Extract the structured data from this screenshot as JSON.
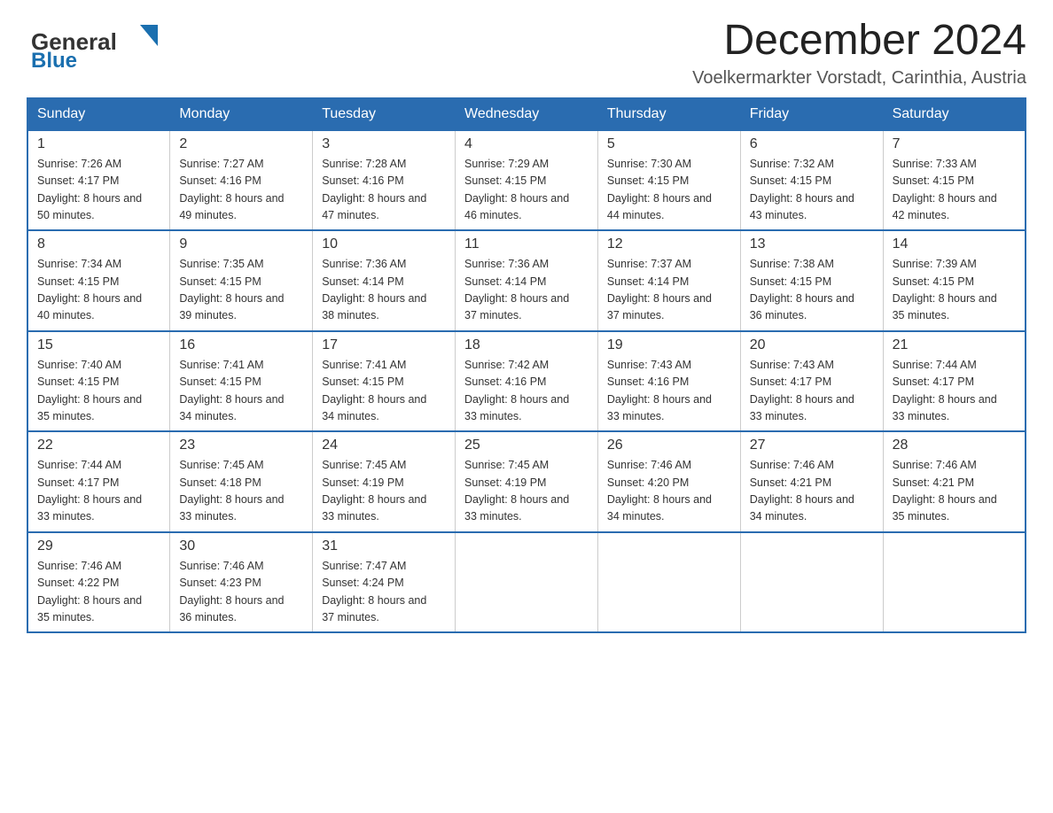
{
  "header": {
    "logo_general": "General",
    "logo_blue": "Blue",
    "month_title": "December 2024",
    "location": "Voelkermarkter Vorstadt, Carinthia, Austria"
  },
  "weekdays": [
    "Sunday",
    "Monday",
    "Tuesday",
    "Wednesday",
    "Thursday",
    "Friday",
    "Saturday"
  ],
  "weeks": [
    [
      {
        "day": "1",
        "sunrise": "7:26 AM",
        "sunset": "4:17 PM",
        "daylight": "8 hours and 50 minutes."
      },
      {
        "day": "2",
        "sunrise": "7:27 AM",
        "sunset": "4:16 PM",
        "daylight": "8 hours and 49 minutes."
      },
      {
        "day": "3",
        "sunrise": "7:28 AM",
        "sunset": "4:16 PM",
        "daylight": "8 hours and 47 minutes."
      },
      {
        "day": "4",
        "sunrise": "7:29 AM",
        "sunset": "4:15 PM",
        "daylight": "8 hours and 46 minutes."
      },
      {
        "day": "5",
        "sunrise": "7:30 AM",
        "sunset": "4:15 PM",
        "daylight": "8 hours and 44 minutes."
      },
      {
        "day": "6",
        "sunrise": "7:32 AM",
        "sunset": "4:15 PM",
        "daylight": "8 hours and 43 minutes."
      },
      {
        "day": "7",
        "sunrise": "7:33 AM",
        "sunset": "4:15 PM",
        "daylight": "8 hours and 42 minutes."
      }
    ],
    [
      {
        "day": "8",
        "sunrise": "7:34 AM",
        "sunset": "4:15 PM",
        "daylight": "8 hours and 40 minutes."
      },
      {
        "day": "9",
        "sunrise": "7:35 AM",
        "sunset": "4:15 PM",
        "daylight": "8 hours and 39 minutes."
      },
      {
        "day": "10",
        "sunrise": "7:36 AM",
        "sunset": "4:14 PM",
        "daylight": "8 hours and 38 minutes."
      },
      {
        "day": "11",
        "sunrise": "7:36 AM",
        "sunset": "4:14 PM",
        "daylight": "8 hours and 37 minutes."
      },
      {
        "day": "12",
        "sunrise": "7:37 AM",
        "sunset": "4:14 PM",
        "daylight": "8 hours and 37 minutes."
      },
      {
        "day": "13",
        "sunrise": "7:38 AM",
        "sunset": "4:15 PM",
        "daylight": "8 hours and 36 minutes."
      },
      {
        "day": "14",
        "sunrise": "7:39 AM",
        "sunset": "4:15 PM",
        "daylight": "8 hours and 35 minutes."
      }
    ],
    [
      {
        "day": "15",
        "sunrise": "7:40 AM",
        "sunset": "4:15 PM",
        "daylight": "8 hours and 35 minutes."
      },
      {
        "day": "16",
        "sunrise": "7:41 AM",
        "sunset": "4:15 PM",
        "daylight": "8 hours and 34 minutes."
      },
      {
        "day": "17",
        "sunrise": "7:41 AM",
        "sunset": "4:15 PM",
        "daylight": "8 hours and 34 minutes."
      },
      {
        "day": "18",
        "sunrise": "7:42 AM",
        "sunset": "4:16 PM",
        "daylight": "8 hours and 33 minutes."
      },
      {
        "day": "19",
        "sunrise": "7:43 AM",
        "sunset": "4:16 PM",
        "daylight": "8 hours and 33 minutes."
      },
      {
        "day": "20",
        "sunrise": "7:43 AM",
        "sunset": "4:17 PM",
        "daylight": "8 hours and 33 minutes."
      },
      {
        "day": "21",
        "sunrise": "7:44 AM",
        "sunset": "4:17 PM",
        "daylight": "8 hours and 33 minutes."
      }
    ],
    [
      {
        "day": "22",
        "sunrise": "7:44 AM",
        "sunset": "4:17 PM",
        "daylight": "8 hours and 33 minutes."
      },
      {
        "day": "23",
        "sunrise": "7:45 AM",
        "sunset": "4:18 PM",
        "daylight": "8 hours and 33 minutes."
      },
      {
        "day": "24",
        "sunrise": "7:45 AM",
        "sunset": "4:19 PM",
        "daylight": "8 hours and 33 minutes."
      },
      {
        "day": "25",
        "sunrise": "7:45 AM",
        "sunset": "4:19 PM",
        "daylight": "8 hours and 33 minutes."
      },
      {
        "day": "26",
        "sunrise": "7:46 AM",
        "sunset": "4:20 PM",
        "daylight": "8 hours and 34 minutes."
      },
      {
        "day": "27",
        "sunrise": "7:46 AM",
        "sunset": "4:21 PM",
        "daylight": "8 hours and 34 minutes."
      },
      {
        "day": "28",
        "sunrise": "7:46 AM",
        "sunset": "4:21 PM",
        "daylight": "8 hours and 35 minutes."
      }
    ],
    [
      {
        "day": "29",
        "sunrise": "7:46 AM",
        "sunset": "4:22 PM",
        "daylight": "8 hours and 35 minutes."
      },
      {
        "day": "30",
        "sunrise": "7:46 AM",
        "sunset": "4:23 PM",
        "daylight": "8 hours and 36 minutes."
      },
      {
        "day": "31",
        "sunrise": "7:47 AM",
        "sunset": "4:24 PM",
        "daylight": "8 hours and 37 minutes."
      },
      null,
      null,
      null,
      null
    ]
  ]
}
